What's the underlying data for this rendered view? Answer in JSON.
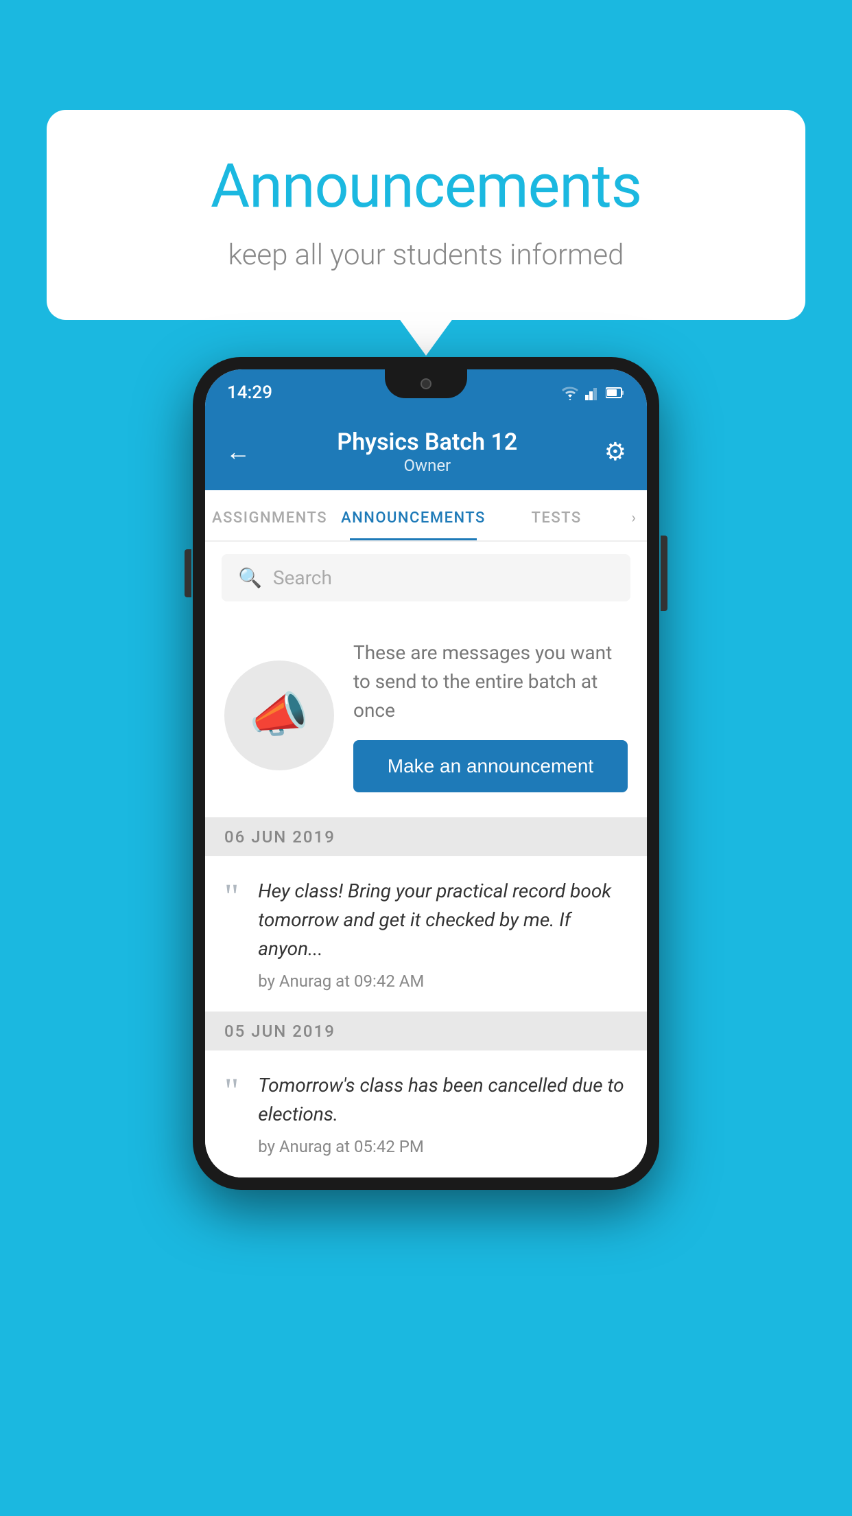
{
  "bubble": {
    "title": "Announcements",
    "subtitle": "keep all your students informed"
  },
  "phone": {
    "status_bar": {
      "time": "14:29"
    },
    "header": {
      "back_label": "←",
      "title": "Physics Batch 12",
      "subtitle": "Owner",
      "gear_label": "⚙"
    },
    "tabs": [
      {
        "label": "ASSIGNMENTS",
        "active": false
      },
      {
        "label": "ANNOUNCEMENTS",
        "active": true
      },
      {
        "label": "TESTS",
        "active": false
      },
      {
        "label": "›",
        "active": false
      }
    ],
    "search": {
      "placeholder": "Search"
    },
    "prompt": {
      "description": "These are messages you want to send to the entire batch at once",
      "button_label": "Make an announcement"
    },
    "announcements": [
      {
        "date": "06  JUN  2019",
        "text": "Hey class! Bring your practical record book tomorrow and get it checked by me. If anyon...",
        "meta": "by Anurag at 09:42 AM"
      },
      {
        "date": "05  JUN  2019",
        "text": "Tomorrow's class has been cancelled due to elections.",
        "meta": "by Anurag at 05:42 PM"
      }
    ]
  }
}
